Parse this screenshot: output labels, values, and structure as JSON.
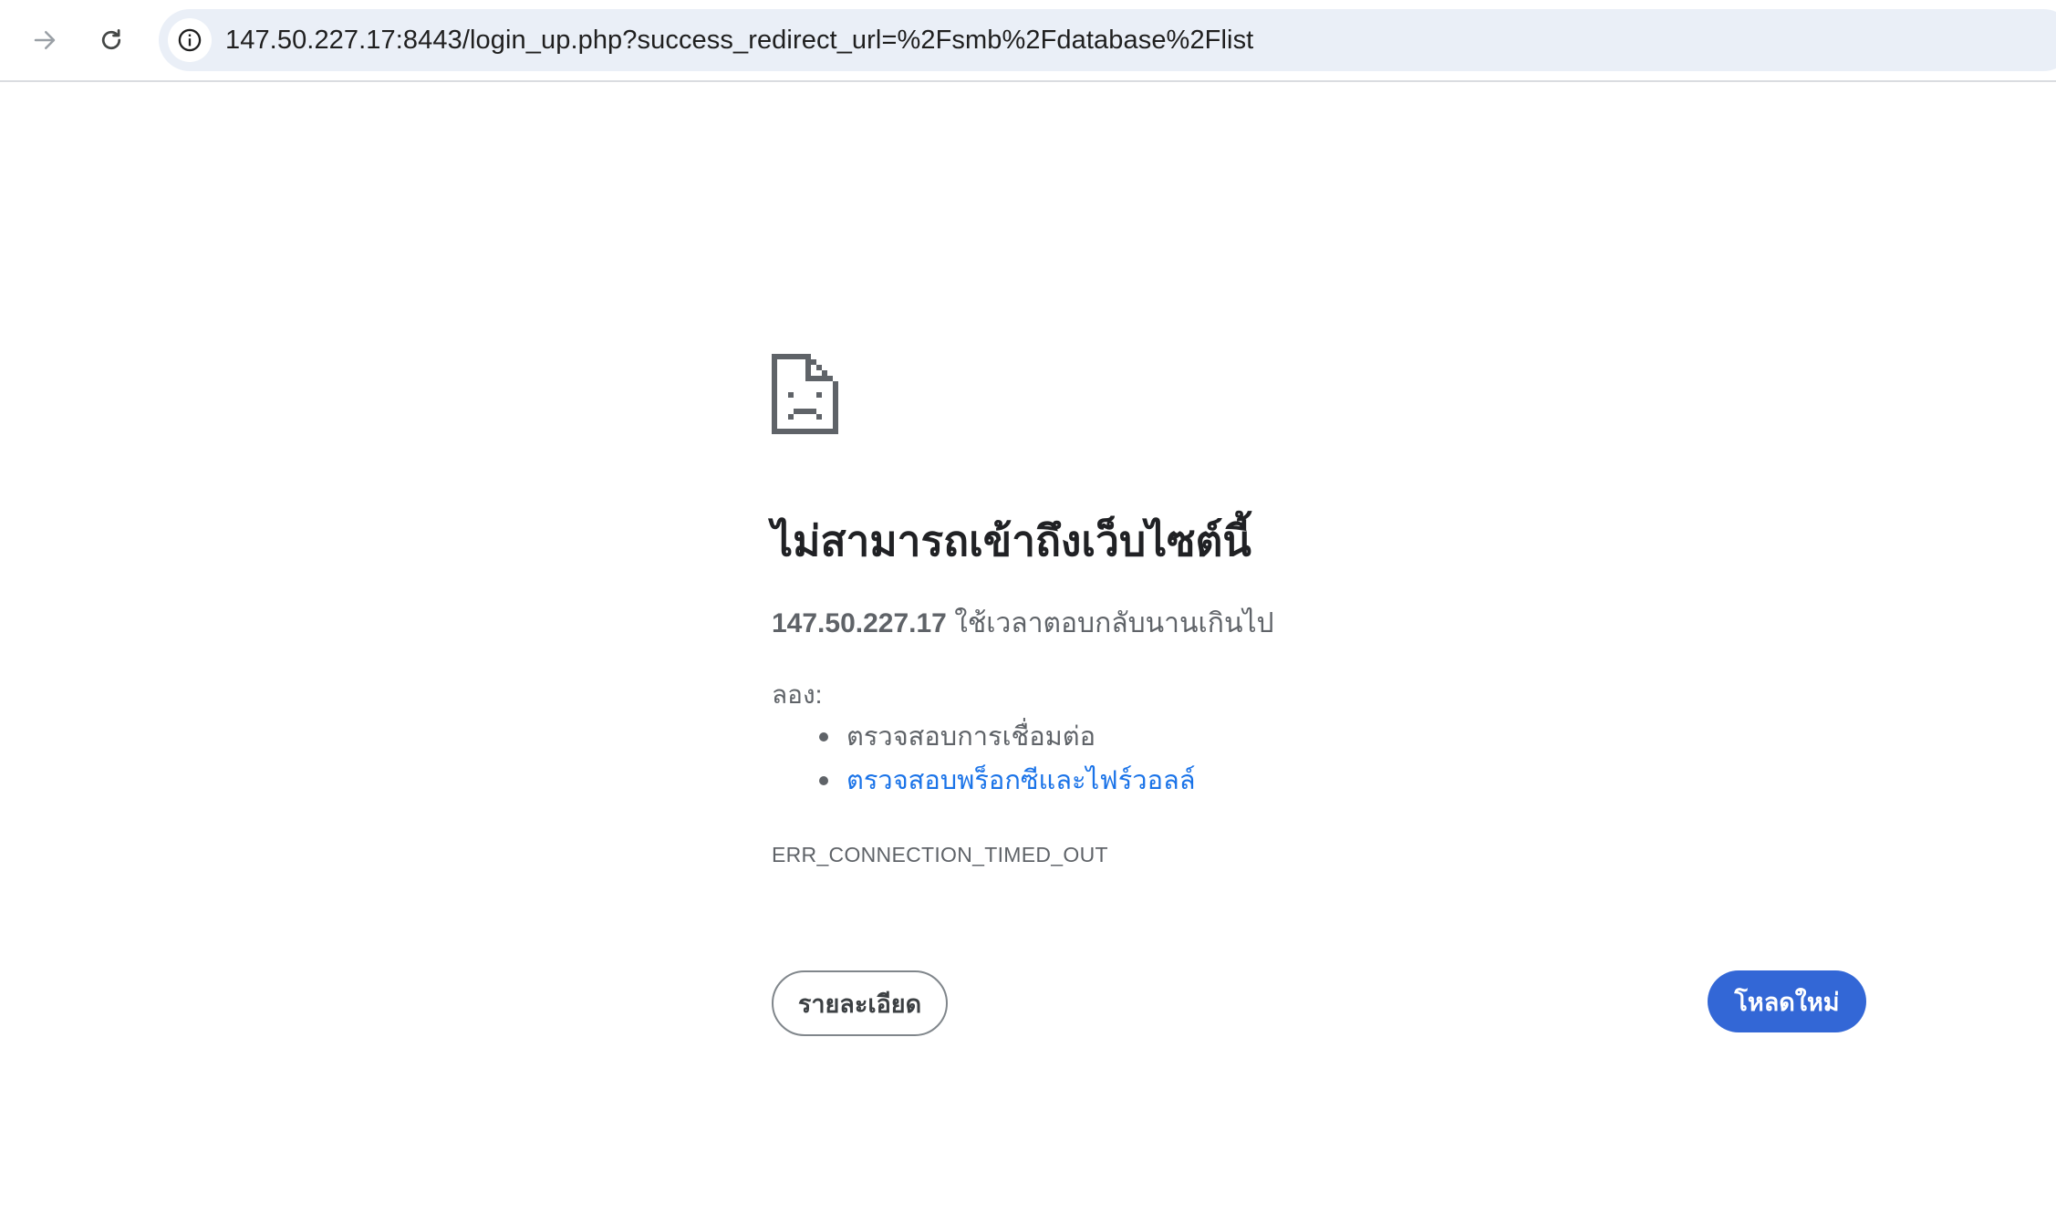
{
  "browser": {
    "url": "147.50.227.17:8443/login_up.php?success_redirect_url=%2Fsmb%2Fdatabase%2Flist",
    "forward_icon": "arrow-right-icon",
    "reload_icon": "reload-icon",
    "site_info_icon": "info-icon"
  },
  "error_page": {
    "icon": "sad-document-icon",
    "heading": "ไม่สามารถเข้าถึงเว็บไซต์นี้",
    "summary_host": "147.50.227.17",
    "summary_text": " ใช้เวลาตอบกลับนานเกินไป",
    "try_label": "ลอง:",
    "suggestions": [
      "ตรวจสอบการเชื่อมต่อ",
      "ตรวจสอบพร็อกซีและไฟร์วอลล์"
    ],
    "error_code": "ERR_CONNECTION_TIMED_OUT",
    "details_button": "รายละเอียด",
    "reload_button": "โหลดใหม่"
  },
  "colors": {
    "primary_button": "#3367d6",
    "link": "#1a73e8",
    "omnibox_bg": "#eaeff7"
  }
}
